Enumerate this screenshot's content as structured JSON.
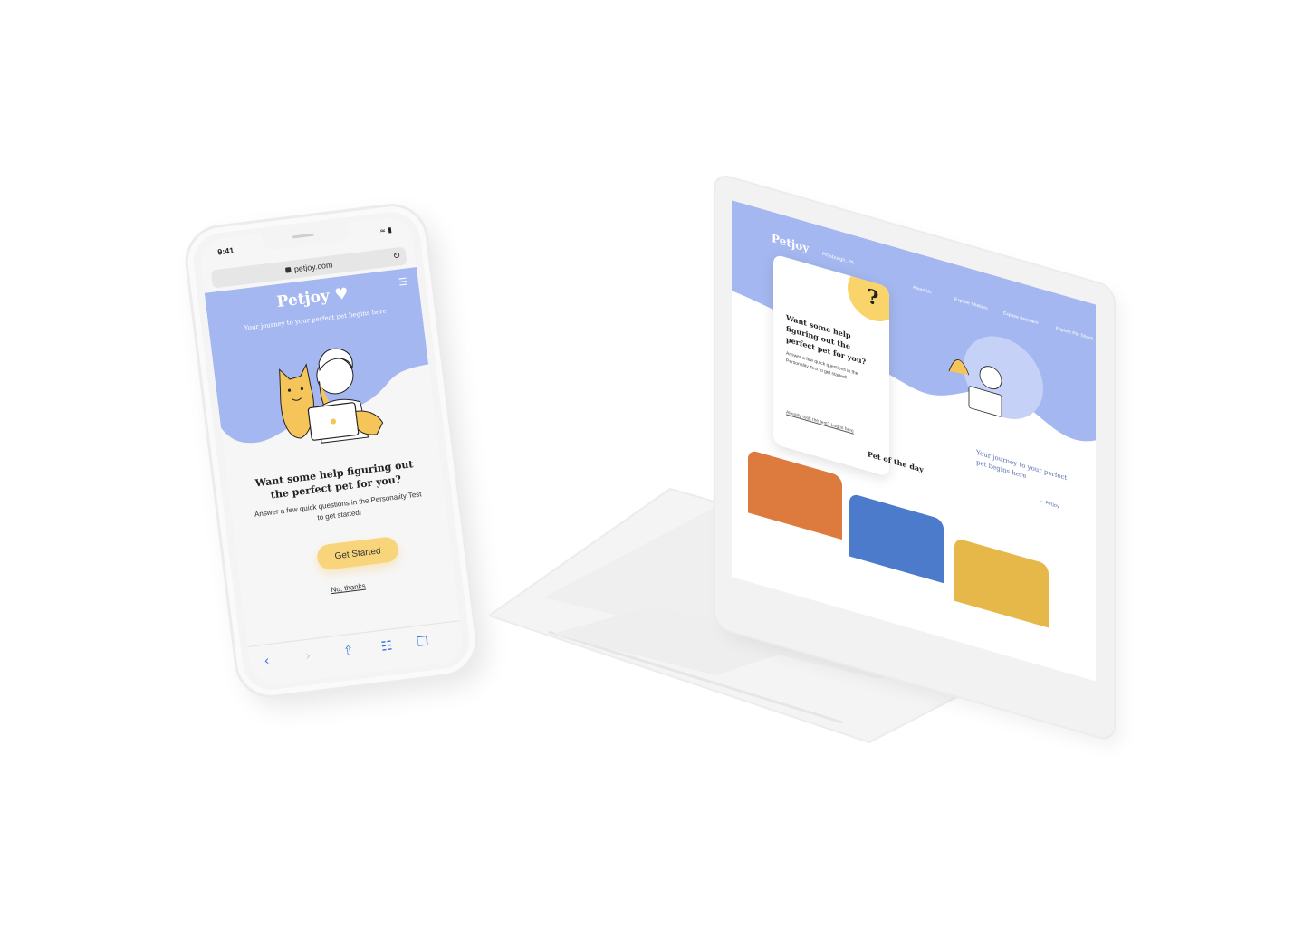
{
  "phone": {
    "status_time": "9:41",
    "url": "petjoy.com",
    "brand": "Petjoy",
    "tagline": "Your journey to your perfect pet begins here",
    "heading": "Want some help figuring out the perfect pet for you?",
    "subtext": "Answer a few quick questions in the Personality Test to get started!",
    "cta_label": "Get Started",
    "dismiss_label": "No, thanks"
  },
  "laptop": {
    "brand": "Petjoy",
    "small_tag": "Pittsburgh, PA",
    "nav": [
      "About Us",
      "Explore Shelters",
      "Explore Breeders",
      "Explore Pet Shops"
    ],
    "card_heading": "Want some help figuring out the perfect pet for you?",
    "card_sub": "Answer a few quick questions in the Personality Test to get started!",
    "card_link": "Already took the test? Log in here",
    "quote": "Your journey to your perfect pet begins here",
    "quote_sig": "— Petjoy",
    "section_title": "Pet of the day"
  },
  "colors": {
    "hero_blue": "#a5b7f0",
    "accent_yellow": "#f8d47a",
    "card_orange": "#dd7a3d",
    "card_blue": "#4d7bcb",
    "card_gold": "#e6b84a"
  },
  "icons": [
    "lock-icon",
    "reload-icon",
    "menu-icon",
    "back-icon",
    "forward-icon",
    "share-icon",
    "bookmarks-icon",
    "tabs-icon",
    "question-icon"
  ]
}
